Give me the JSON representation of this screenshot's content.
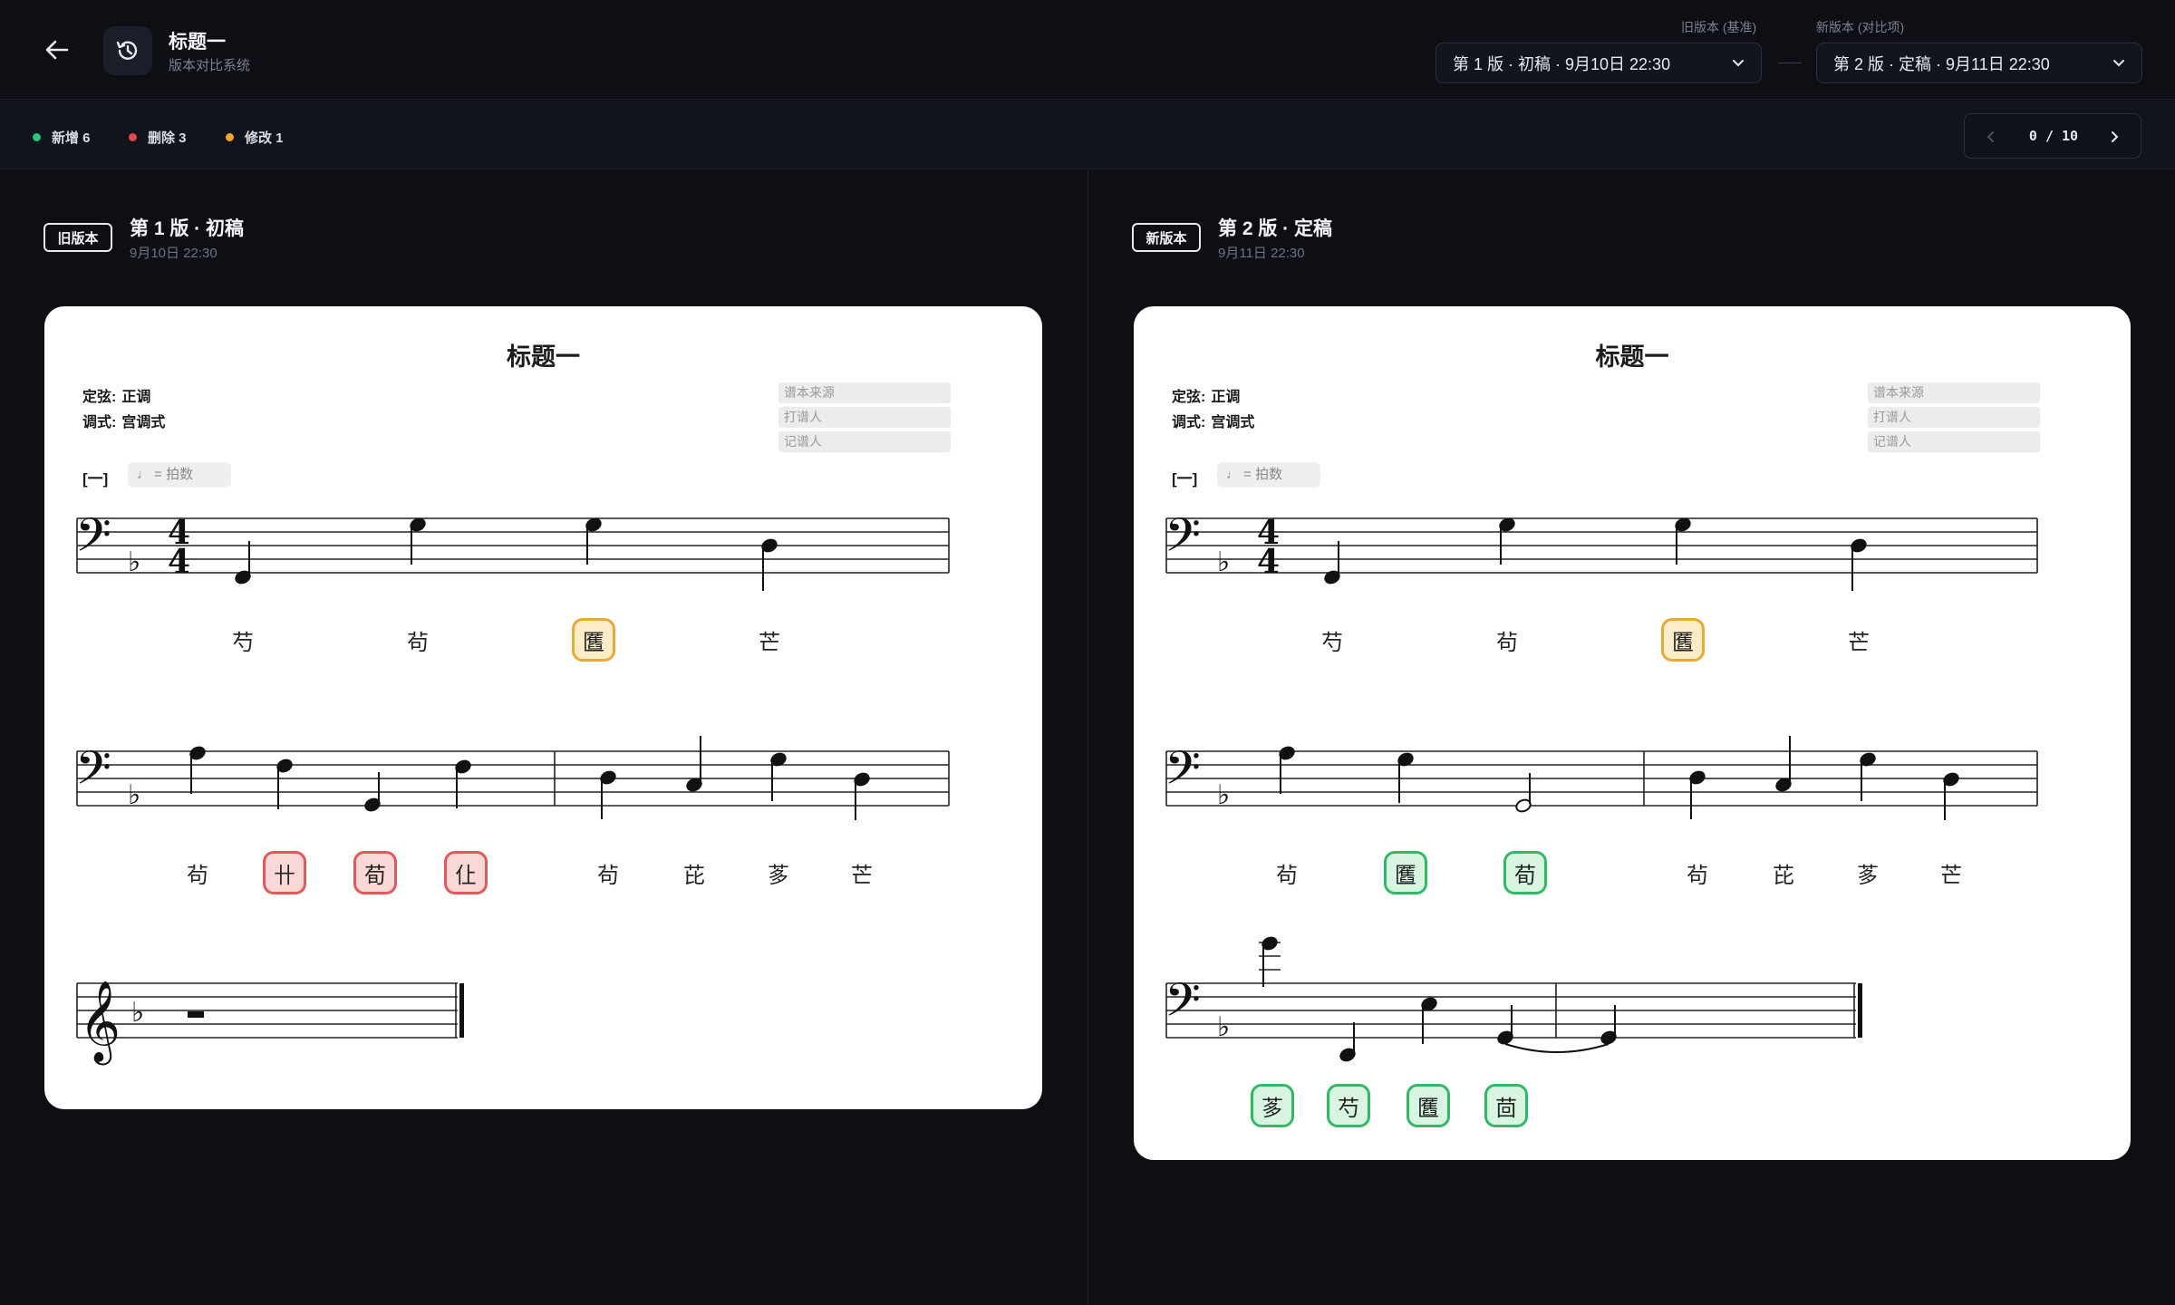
{
  "header": {
    "title": "标题一",
    "subtitle": "版本对比系统",
    "old_label": "旧版本 (基准)",
    "new_label": "新版本 (对比项)",
    "old_value": "第 1 版 · 初稿 · 9月10日 22:30",
    "new_value": "第 2 版 · 定稿 · 9月11日 22:30"
  },
  "stats": {
    "added": "新增 6",
    "deleted": "删除 3",
    "modified": "修改 1",
    "colors": {
      "added": "#2ec27e",
      "deleted": "#e5484d",
      "modified": "#f5a623"
    }
  },
  "pager": {
    "text": "0 / 10"
  },
  "left": {
    "badge": "旧版本",
    "title": "第 1 版 · 初稿",
    "date": "9月10日 22:30",
    "score": {
      "title": "标题一",
      "tuning_label": "定弦:",
      "tuning": "正调",
      "mode_label": "调式:",
      "mode": "宫调式",
      "source_placeholder": "谱本来源",
      "arranger_placeholder": "打谱人",
      "transcriber_placeholder": "记谱人",
      "section": "[一]",
      "tempo_placeholder": "♩ = 拍数",
      "row1_glyphs": [
        {
          "char": "芍",
          "state": "plain"
        },
        {
          "char": "茍",
          "state": "plain"
        },
        {
          "char": "匶",
          "state": "modified"
        },
        {
          "char": "芒",
          "state": "plain"
        }
      ],
      "row2_glyphs": [
        {
          "char": "茍",
          "state": "plain"
        },
        {
          "char": "卄",
          "state": "deleted"
        },
        {
          "char": "荀",
          "state": "deleted"
        },
        {
          "char": "仩",
          "state": "deleted"
        },
        {
          "char": "茍",
          "state": "plain"
        },
        {
          "char": "芘",
          "state": "plain"
        },
        {
          "char": "茤",
          "state": "plain"
        },
        {
          "char": "芒",
          "state": "plain"
        }
      ]
    }
  },
  "right": {
    "badge": "新版本",
    "title": "第 2 版 · 定稿",
    "date": "9月11日 22:30",
    "score": {
      "title": "标题一",
      "tuning_label": "定弦:",
      "tuning": "正调",
      "mode_label": "调式:",
      "mode": "宫调式",
      "source_placeholder": "谱本来源",
      "arranger_placeholder": "打谱人",
      "transcriber_placeholder": "记谱人",
      "section": "[一]",
      "tempo_placeholder": "♩ = 拍数",
      "row1_glyphs": [
        {
          "char": "芍",
          "state": "plain"
        },
        {
          "char": "茍",
          "state": "plain"
        },
        {
          "char": "匶",
          "state": "modified"
        },
        {
          "char": "芒",
          "state": "plain"
        }
      ],
      "row2_glyphs": [
        {
          "char": "茍",
          "state": "plain"
        },
        {
          "char": "匶",
          "state": "added"
        },
        {
          "char": "荀",
          "state": "added"
        },
        {
          "char": "茍",
          "state": "plain"
        },
        {
          "char": "芘",
          "state": "plain"
        },
        {
          "char": "茤",
          "state": "plain"
        },
        {
          "char": "芒",
          "state": "plain"
        }
      ],
      "row3_glyphs": [
        {
          "char": "茤",
          "state": "added"
        },
        {
          "char": "芍",
          "state": "added"
        },
        {
          "char": "匶",
          "state": "added"
        },
        {
          "char": "茴",
          "state": "added"
        }
      ]
    }
  }
}
